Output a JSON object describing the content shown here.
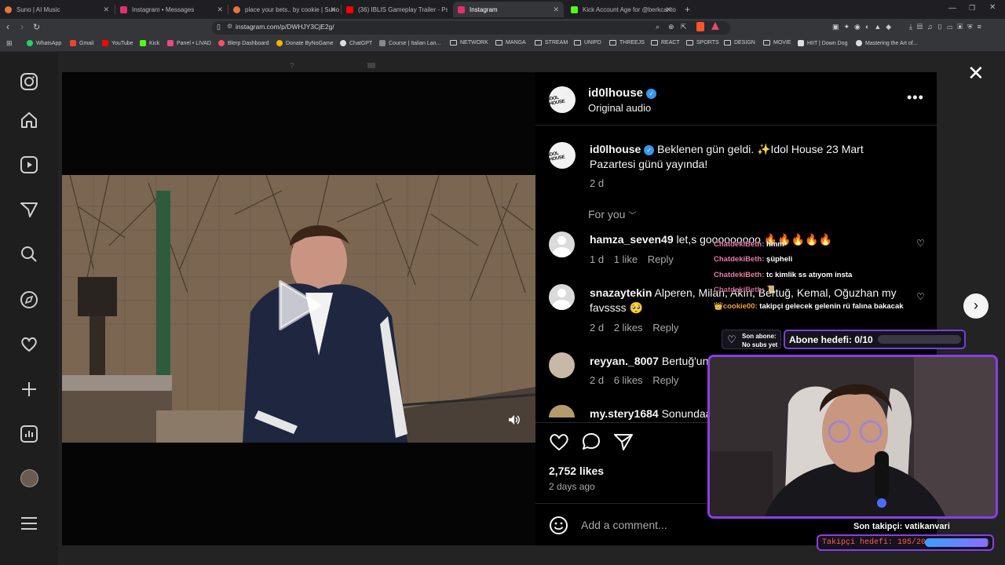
{
  "browser": {
    "tabs": [
      {
        "label": "Suno | AI Music",
        "color": "#e8743b"
      },
      {
        "label": "Instagram • Messages",
        "color": "#e1306c"
      },
      {
        "label": "place your bets.. by cookie | Suno",
        "color": "#e8743b"
      },
      {
        "label": "(36) IBLIS Gameplay Trailer - Psychol",
        "color": "#ff0000"
      },
      {
        "label": "Instagram",
        "color": "#e1306c"
      },
      {
        "label": "Kick Account Age for @berkcantop...",
        "color": "#53fc18"
      }
    ],
    "new_tab": "+",
    "url": "instagram.com/p/DWHJY3CjE2g/"
  },
  "bookmarks": [
    {
      "label": "WhatsApp",
      "icon": "whatsapp-icon",
      "color": "#25d366"
    },
    {
      "label": "Gmail",
      "icon": "gmail-icon",
      "color": "#ea4335"
    },
    {
      "label": "YouTube",
      "icon": "youtube-icon",
      "color": "#ff0000"
    },
    {
      "label": "Kick",
      "icon": "kick-icon",
      "color": "#53fc18"
    },
    {
      "label": "Panel • LIVAD",
      "icon": "livad-icon",
      "color": "#e84a7f"
    },
    {
      "label": "Blerp Dashboard",
      "icon": "blerp-icon",
      "color": "#ff4d6d"
    },
    {
      "label": "Donate ByNoGame",
      "icon": "bynogame-icon",
      "color": "#f4b400"
    },
    {
      "label": "ChatGPT",
      "icon": "chatgpt-icon",
      "color": "#dddddd"
    },
    {
      "label": "Course | Italian Lan...",
      "icon": "course-icon",
      "color": "#888888"
    },
    {
      "label": "NETWORK",
      "icon": "folder-icon"
    },
    {
      "label": "MANGA",
      "icon": "folder-icon"
    },
    {
      "label": "STREAM",
      "icon": "folder-icon"
    },
    {
      "label": "UNIPD",
      "icon": "folder-icon"
    },
    {
      "label": "THREEJS",
      "icon": "folder-icon"
    },
    {
      "label": "REACT",
      "icon": "folder-icon"
    },
    {
      "label": "SPORTS",
      "icon": "folder-icon"
    },
    {
      "label": "DESIGN",
      "icon": "folder-icon"
    },
    {
      "label": "MOVIE",
      "icon": "folder-icon"
    },
    {
      "label": "HIIT | Down Dog",
      "icon": "downdog-icon",
      "color": "#dddddd"
    },
    {
      "label": "Mastering the Art of...",
      "icon": "medium-icon",
      "color": "#dddddd"
    }
  ],
  "post": {
    "author": "id0lhouse",
    "audio": "Original audio",
    "caption_author": "id0lhouse",
    "caption": "Beklenen gün geldi. ✨Idol House 23 Mart Pazartesi günü yayında!",
    "caption_age": "2 d",
    "sort_label": "For you",
    "likes": "2,752 likes",
    "posted": "2 days ago",
    "add_comment_placeholder": "Add a comment..."
  },
  "comments": [
    {
      "user": "hamza_seven49",
      "text": "let,s gooooooooo 🔥🔥🔥🔥🔥",
      "age": "1 d",
      "likes": "1 like",
      "reply": "Reply"
    },
    {
      "user": "snazaytekin",
      "text": "Alperen, Milan, Akın, Bertuğ, Kemal, Oğuzhan my favssss 🥺",
      "age": "2 d",
      "likes": "2 likes",
      "reply": "Reply"
    },
    {
      "user": "reyyan._8007",
      "text": "Bertuğ'un",
      "age": "2 d",
      "likes": "6 likes",
      "reply": "Reply"
    },
    {
      "user": "my.stery1684",
      "text": "Sonundaa"
    }
  ],
  "overlay": {
    "chat": [
      {
        "nick": "ChatdekiBeth:",
        "msg": "hmm"
      },
      {
        "nick": "ChatdekiBeth:",
        "msg": "şüpheli"
      },
      {
        "nick": "ChatdekiBeth:",
        "msg": "tc kimlik ss atıyom insta"
      },
      {
        "nick": "ChatdekiBeth:",
        "msg": "📜"
      },
      {
        "nick": "👑cookie00:",
        "msg": "takipçi gelecek gelenin rü falına bakacak"
      }
    ],
    "sub_label": "Son abone:",
    "sub_value": "No subs yet",
    "sub_goal": "Abone hedefi: 0/10",
    "sub_goal_progress": 0.0,
    "last_follower": "Son takipçi: vatikanvari",
    "follower_goal": "Takipçi hedefi: 195/200",
    "follower_goal_progress": 0.975
  }
}
